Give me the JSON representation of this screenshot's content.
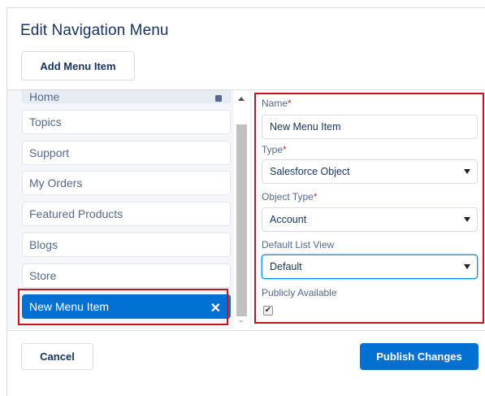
{
  "dialog": {
    "title": "Edit Navigation Menu"
  },
  "toolbar": {
    "add_label": "Add Menu Item"
  },
  "menu": {
    "home": "Home",
    "items": [
      {
        "label": "Topics"
      },
      {
        "label": "Support"
      },
      {
        "label": "My Orders"
      },
      {
        "label": "Featured Products"
      },
      {
        "label": "Blogs"
      },
      {
        "label": "Store"
      }
    ],
    "selected": {
      "label": "New Menu Item",
      "close": "✕"
    }
  },
  "form": {
    "name": {
      "label": "Name",
      "value": "New Menu Item"
    },
    "type": {
      "label": "Type",
      "value": "Salesforce Object"
    },
    "object_type": {
      "label": "Object Type",
      "value": "Account"
    },
    "default_list_view": {
      "label": "Default List View",
      "value": "Default"
    },
    "publicly_available": {
      "label": "Publicly Available",
      "checked": true
    },
    "required_mark": "*"
  },
  "footer": {
    "cancel_label": "Cancel",
    "publish_label": "Publish Changes"
  },
  "colors": {
    "accent": "#0070d2",
    "highlight": "#c3161c",
    "text": "#16325c",
    "muted": "#54698d"
  }
}
